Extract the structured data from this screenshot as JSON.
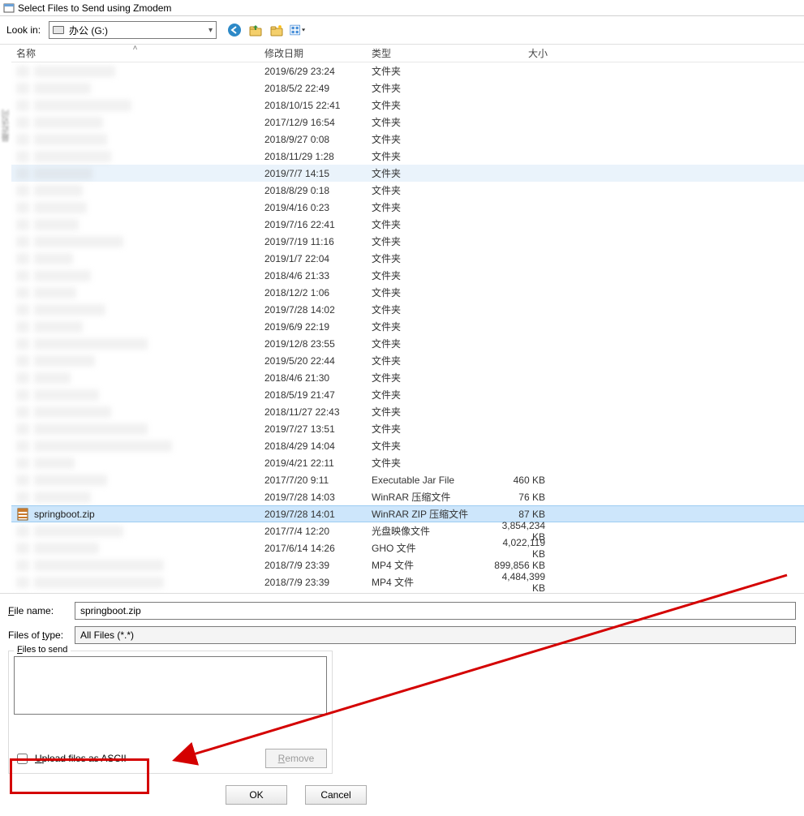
{
  "window": {
    "title": "Select Files to Send using Zmodem"
  },
  "lookin": {
    "label": "Look in:",
    "value": "办公 (G:)"
  },
  "columns": {
    "name": "名称",
    "date": "修改日期",
    "type": "类型",
    "size": "大小"
  },
  "typeFolder": "文件夹",
  "rows": [
    {
      "blur": true,
      "nameW": 100,
      "date": "2019/6/29 23:24",
      "type": "文件夹",
      "size": ""
    },
    {
      "blur": true,
      "nameW": 70,
      "date": "2018/5/2 22:49",
      "type": "文件夹",
      "size": ""
    },
    {
      "blur": true,
      "nameW": 120,
      "date": "2018/10/15 22:41",
      "type": "文件夹",
      "size": ""
    },
    {
      "blur": true,
      "nameW": 85,
      "date": "2017/12/9 16:54",
      "type": "文件夹",
      "size": ""
    },
    {
      "blur": true,
      "nameW": 90,
      "date": "2018/9/27 0:08",
      "type": "文件夹",
      "size": ""
    },
    {
      "blur": true,
      "nameW": 95,
      "date": "2018/11/29 1:28",
      "type": "文件夹",
      "size": ""
    },
    {
      "blur": true,
      "nameW": 72,
      "date": "2019/7/7 14:15",
      "type": "文件夹",
      "size": "",
      "hl": true
    },
    {
      "blur": true,
      "nameW": 60,
      "date": "2018/8/29 0:18",
      "type": "文件夹",
      "size": ""
    },
    {
      "blur": true,
      "nameW": 65,
      "date": "2019/4/16 0:23",
      "type": "文件夹",
      "size": ""
    },
    {
      "blur": true,
      "nameW": 55,
      "date": "2019/7/16 22:41",
      "type": "文件夹",
      "size": ""
    },
    {
      "blur": true,
      "nameW": 110,
      "date": "2019/7/19 11:16",
      "type": "文件夹",
      "size": ""
    },
    {
      "blur": true,
      "nameW": 48,
      "date": "2019/1/7 22:04",
      "type": "文件夹",
      "size": ""
    },
    {
      "blur": true,
      "nameW": 70,
      "date": "2018/4/6 21:33",
      "type": "文件夹",
      "size": ""
    },
    {
      "blur": true,
      "nameW": 52,
      "date": "2018/12/2 1:06",
      "type": "文件夹",
      "size": ""
    },
    {
      "blur": true,
      "nameW": 88,
      "date": "2019/7/28 14:02",
      "type": "文件夹",
      "size": ""
    },
    {
      "blur": true,
      "nameW": 60,
      "date": "2019/6/9 22:19",
      "type": "文件夹",
      "size": ""
    },
    {
      "blur": true,
      "nameW": 140,
      "date": "2019/12/8 23:55",
      "type": "文件夹",
      "size": ""
    },
    {
      "blur": true,
      "nameW": 75,
      "date": "2019/5/20 22:44",
      "type": "文件夹",
      "size": ""
    },
    {
      "blur": true,
      "nameW": 45,
      "date": "2018/4/6 21:30",
      "type": "文件夹",
      "size": ""
    },
    {
      "blur": true,
      "nameW": 80,
      "date": "2018/5/19 21:47",
      "type": "文件夹",
      "size": ""
    },
    {
      "blur": true,
      "nameW": 95,
      "date": "2018/11/27 22:43",
      "type": "文件夹",
      "size": ""
    },
    {
      "blur": true,
      "nameW": 140,
      "date": "2019/7/27 13:51",
      "type": "文件夹",
      "size": ""
    },
    {
      "blur": true,
      "nameW": 170,
      "date": "2018/4/29 14:04",
      "type": "文件夹",
      "size": ""
    },
    {
      "blur": true,
      "nameW": 50,
      "date": "2019/4/21 22:11",
      "type": "文件夹",
      "size": ""
    },
    {
      "blur": true,
      "nameW": 90,
      "date": "2017/7/20 9:11",
      "type": "Executable Jar File",
      "size": "460 KB"
    },
    {
      "blur": true,
      "nameW": 70,
      "date": "2019/7/28 14:03",
      "type": "WinRAR 压缩文件",
      "size": "76 KB"
    },
    {
      "blur": false,
      "name": "springboot.zip",
      "icon": "zip",
      "date": "2019/7/28 14:01",
      "type": "WinRAR ZIP 压缩文件",
      "size": "87 KB",
      "sel": true
    },
    {
      "blur": true,
      "nameW": 110,
      "date": "2017/7/4 12:20",
      "type": "光盘映像文件",
      "size": "3,854,234 KB"
    },
    {
      "blur": true,
      "nameW": 80,
      "date": "2017/6/14 14:26",
      "type": "GHO 文件",
      "size": "4,022,119 KB"
    },
    {
      "blur": true,
      "nameW": 160,
      "date": "2018/7/9 23:39",
      "type": "MP4 文件",
      "size": "899,856 KB"
    },
    {
      "blur": true,
      "nameW": 160,
      "date": "2018/7/9 23:39",
      "type": "MP4 文件",
      "size": "4,484,399 KB"
    }
  ],
  "filename": {
    "label": "File name:",
    "value": "springboot.zip"
  },
  "filetype": {
    "label": "Files of type:",
    "value": "All Files (*.*)"
  },
  "sendgroup": {
    "legend": "Files to send"
  },
  "ascii": {
    "label": "Upload files as ASCII"
  },
  "buttons": {
    "remove": "Remove",
    "ok": "OK",
    "cancel": "Cancel"
  }
}
